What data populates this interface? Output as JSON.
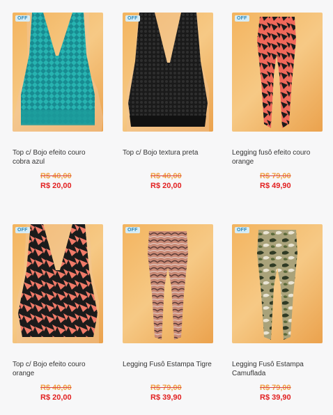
{
  "products": [
    {
      "badge": "OFF",
      "name": "Top c/ Bojo efeito couro cobra azul",
      "old_price": "R$ 40,00",
      "new_price": "R$ 20,00",
      "icon": "teal-snake-bikini-top"
    },
    {
      "badge": "OFF",
      "name": "Top c/ Bojo textura preta",
      "old_price": "R$ 40,00",
      "new_price": "R$ 20,00",
      "icon": "black-textured-bikini-top"
    },
    {
      "badge": "OFF",
      "name": "Legging fusô efeito couro orange",
      "old_price": "R$ 79,00",
      "new_price": "R$ 49,90",
      "icon": "orange-pattern-legging"
    },
    {
      "badge": "OFF",
      "name": "Top c/ Bojo efeito couro orange",
      "old_price": "R$ 40,00",
      "new_price": "R$ 20,00",
      "icon": "orange-pattern-bikini-top"
    },
    {
      "badge": "OFF",
      "name": "Legging Fusô Estampa Tigre",
      "old_price": "R$ 79,00",
      "new_price": "R$ 39,90",
      "icon": "tiger-print-legging"
    },
    {
      "badge": "OFF",
      "name": "Legging Fusô Estampa Camuflada",
      "old_price": "R$ 79,00",
      "new_price": "R$ 39,90",
      "icon": "camouflage-legging"
    }
  ],
  "colors": {
    "badge_bg": "#d5ecf6",
    "badge_text": "#2d86b4",
    "old_price": "#f0a142",
    "new_price": "#e22020",
    "photo_bg": "#f3b45f"
  }
}
